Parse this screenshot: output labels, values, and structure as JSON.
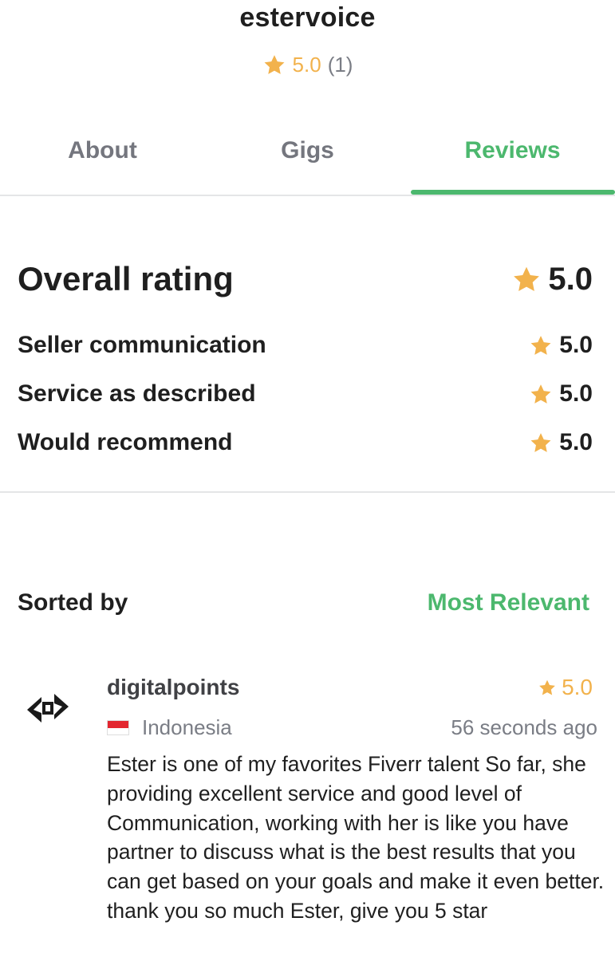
{
  "profile": {
    "username": "estervoice",
    "rating": "5.0",
    "review_count": "(1)"
  },
  "tabs": [
    {
      "label": "About",
      "active": false
    },
    {
      "label": "Gigs",
      "active": false
    },
    {
      "label": "Reviews",
      "active": true
    }
  ],
  "ratings": {
    "overall_label": "Overall rating",
    "overall_value": "5.0",
    "breakdown": [
      {
        "label": "Seller communication",
        "value": "5.0"
      },
      {
        "label": "Service as described",
        "value": "5.0"
      },
      {
        "label": "Would recommend",
        "value": "5.0"
      }
    ]
  },
  "sort": {
    "label": "Sorted by",
    "value": "Most Relevant"
  },
  "review": {
    "reviewer": "digitalpoints",
    "rating": "5.0",
    "country": "Indonesia",
    "time_ago": "56 seconds ago",
    "text": "Ester is one of my favorites Fiverr talent So far, she providing excellent service and good level of Communication, working with her is like you have partner to discuss what is the best results that you can get based on your goals and make it even better. thank you so much Ester, give you 5 star"
  },
  "colors": {
    "accent_green": "#4cb86e",
    "star_yellow": "#f2b24c",
    "muted_gray": "#74767e",
    "divider": "#e4e5e7"
  },
  "icons": {
    "star": "star-icon",
    "flag": "indonesia-flag-icon",
    "avatar": "digitalpoints-logo"
  }
}
